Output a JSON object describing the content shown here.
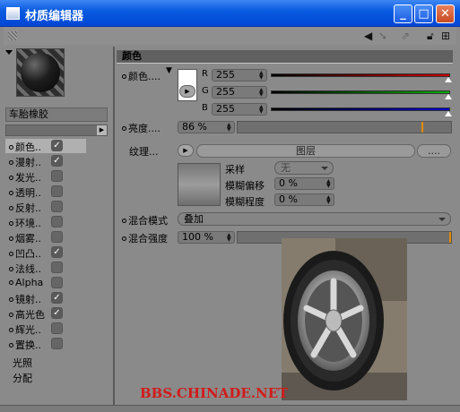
{
  "window": {
    "title": "材质编辑器"
  },
  "toolbar": {
    "icons": [
      "grip-icon",
      "arrow-left-icon",
      "arrow-right-icon",
      "lock-icon",
      "new-window-icon"
    ]
  },
  "material": {
    "name": "车胎橡胶"
  },
  "channels": [
    {
      "label": "颜色",
      "dots": "..",
      "checked": true,
      "selected": true
    },
    {
      "label": "漫射",
      "dots": "..",
      "checked": true
    },
    {
      "label": "发光",
      "dots": "..",
      "checked": false
    },
    {
      "label": "透明",
      "dots": "..",
      "checked": false
    },
    {
      "label": "反射",
      "dots": "..",
      "checked": false
    },
    {
      "label": "环境",
      "dots": "..",
      "checked": false
    },
    {
      "label": "烟雾",
      "dots": "..",
      "checked": false
    },
    {
      "label": "凹凸",
      "dots": "..",
      "checked": true
    },
    {
      "label": "法线",
      "dots": "..",
      "checked": false
    },
    {
      "label": "Alpha",
      "dots": "",
      "checked": false
    },
    {
      "label": "镜射",
      "dots": "..",
      "checked": true
    },
    {
      "label": "高光色",
      "dots": "",
      "checked": true
    },
    {
      "label": "辉光",
      "dots": "..",
      "checked": false
    },
    {
      "label": "置换",
      "dots": "..",
      "checked": false
    }
  ],
  "extra_items": [
    "光照",
    "分配"
  ],
  "section": {
    "title": "颜色"
  },
  "color": {
    "label": "颜色",
    "dots": "....",
    "swatch": "#ffffff",
    "channels": [
      {
        "key": "R",
        "value": "255",
        "bar_color": "#cc0000"
      },
      {
        "key": "G",
        "value": "255",
        "bar_color": "#00aa00"
      },
      {
        "key": "B",
        "value": "255",
        "bar_color": "#0000cc"
      }
    ],
    "rgb_fraction": 1.0
  },
  "brightness": {
    "label": "亮度",
    "dots": "....",
    "value": "86 %",
    "level": 0.86
  },
  "texture": {
    "label": "纹理",
    "dots": "...",
    "layer_button": "图层",
    "more_button": "....",
    "sampling_label": "采样",
    "sampling_value": "无",
    "blur_offset_label": "模糊偏移",
    "blur_offset_value": "0 %",
    "blur_scale_label": "模糊程度",
    "blur_scale_value": "0 %"
  },
  "mix_mode": {
    "label": "混合模式",
    "value": "叠加"
  },
  "mix_strength": {
    "label": "混合强度",
    "value": "100 %",
    "level": 1.0
  },
  "watermark": "BBS.CHINADE.NET"
}
